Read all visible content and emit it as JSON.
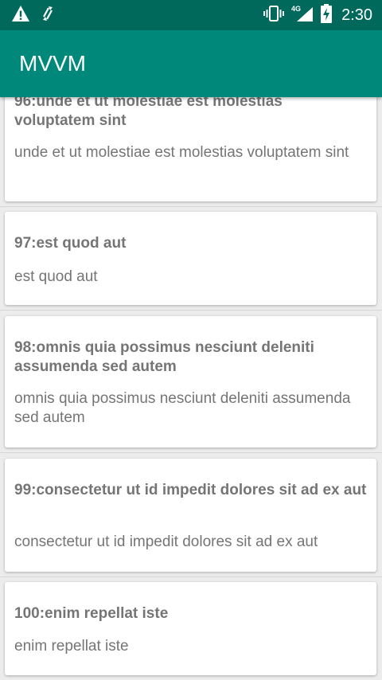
{
  "status_bar": {
    "time": "2:30",
    "network_label": "4G",
    "icons": [
      "warning-icon",
      "sync-icon",
      "vibrate-icon",
      "signal-icon",
      "battery-charging-icon"
    ]
  },
  "app_bar": {
    "title": "MVVM"
  },
  "colors": {
    "status_bar": "#00695c",
    "app_bar": "#00897b",
    "text": "#757575"
  },
  "items": [
    {
      "title": "96:unde et ut molestiae est molestias voluptatem sint",
      "body": "unde et ut molestiae est molestias voluptatem sint"
    },
    {
      "title": "97:est quod aut",
      "body": "est quod aut"
    },
    {
      "title": "98:omnis quia possimus nesciunt deleniti assumenda sed autem",
      "body": "omnis quia possimus nesciunt deleniti assumenda sed autem"
    },
    {
      "title": "99:consectetur ut id impedit dolores sit ad ex aut",
      "body": "consectetur ut id impedit dolores sit ad ex aut"
    },
    {
      "title": "100:enim repellat iste",
      "body": "enim repellat iste"
    }
  ]
}
